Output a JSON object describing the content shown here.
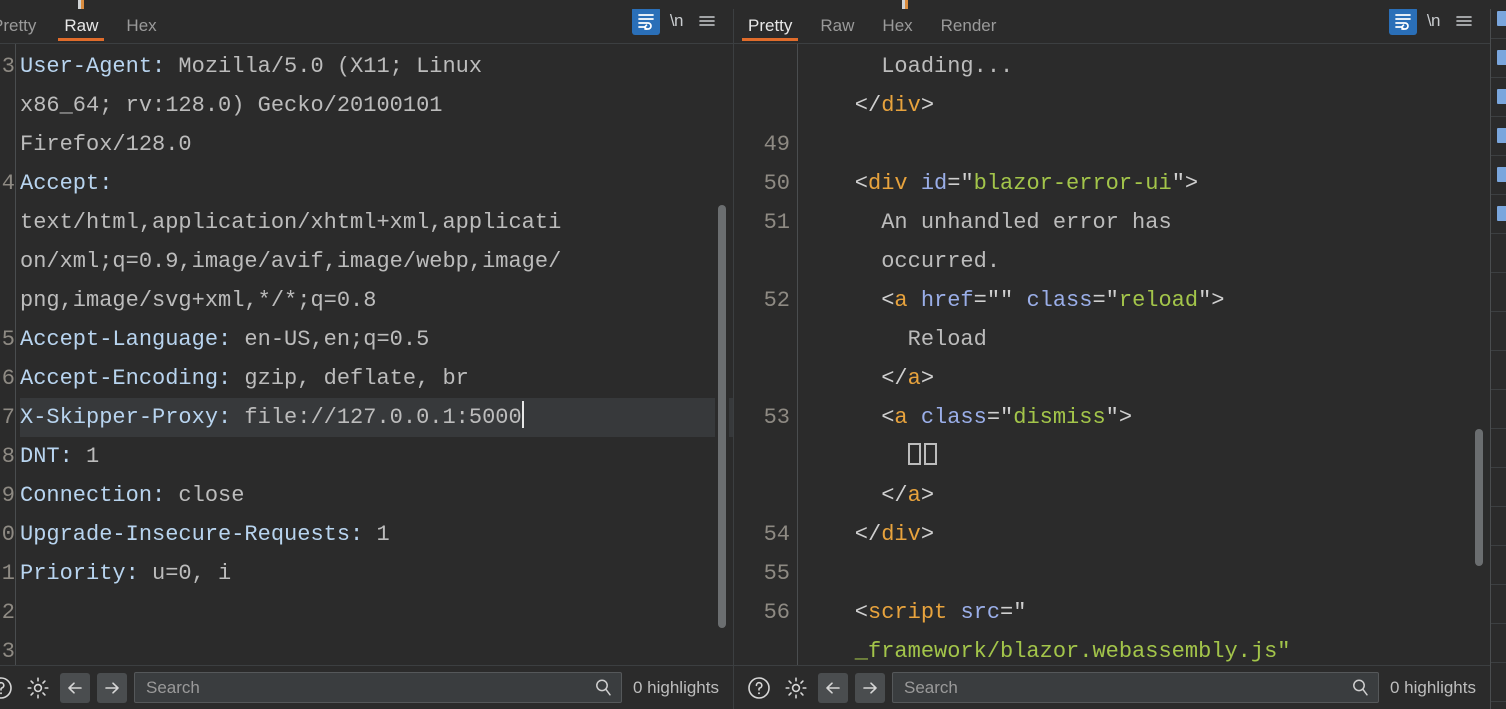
{
  "theme": {
    "background": "#2b2b2b",
    "accent_underline": "#e06c2b",
    "toggle_active": "#2a6fb8",
    "gutter_text": "#8e8a83",
    "tag_color": "#e8a33d",
    "attr_color": "#9aaee8",
    "string_color": "#a3c54a",
    "header_name_color": "#b8d4ef",
    "current_line_bg": "#37393b"
  },
  "request_panel": {
    "name": "request",
    "tabs": [
      {
        "label": "Pretty",
        "active": false,
        "clipped": true
      },
      {
        "label": "Raw",
        "active": true,
        "clipped": false
      },
      {
        "label": "Hex",
        "active": false,
        "clipped": false
      }
    ],
    "actions": {
      "wrap_icon": "word-wrap-icon",
      "wrap_active": true,
      "newline_label": "\\n",
      "menu_icon": "hamburger-menu-icon"
    },
    "line_numbers": [
      "3",
      "",
      "",
      "4",
      "",
      "",
      "",
      "5",
      "6",
      "7",
      "8",
      "9",
      "0",
      "1",
      "2",
      "3"
    ],
    "lines": [
      {
        "number": "3",
        "current": false,
        "tokens": [
          {
            "cls": "t-hdr",
            "text": "User-Agent:"
          },
          {
            "cls": "t-val",
            "text": " Mozilla/5.0 (X11; Linux"
          }
        ]
      },
      {
        "number": "",
        "current": false,
        "tokens": [
          {
            "cls": "t-val",
            "text": "x86_64; rv:128.0) Gecko/20100101"
          }
        ]
      },
      {
        "number": "",
        "current": false,
        "tokens": [
          {
            "cls": "t-val",
            "text": "Firefox/128.0"
          }
        ]
      },
      {
        "number": "4",
        "current": false,
        "tokens": [
          {
            "cls": "t-hdr",
            "text": "Accept:"
          }
        ]
      },
      {
        "number": "",
        "current": false,
        "tokens": [
          {
            "cls": "t-val",
            "text": "text/html,application/xhtml+xml,applicati"
          }
        ]
      },
      {
        "number": "",
        "current": false,
        "tokens": [
          {
            "cls": "t-val",
            "text": "on/xml;q=0.9,image/avif,image/webp,image/"
          }
        ]
      },
      {
        "number": "",
        "current": false,
        "tokens": [
          {
            "cls": "t-val",
            "text": "png,image/svg+xml,*/*;q=0.8"
          }
        ]
      },
      {
        "number": "5",
        "current": false,
        "tokens": [
          {
            "cls": "t-hdr",
            "text": "Accept-Language:"
          },
          {
            "cls": "t-val",
            "text": " en-US,en;q=0.5"
          }
        ]
      },
      {
        "number": "6",
        "current": false,
        "tokens": [
          {
            "cls": "t-hdr",
            "text": "Accept-Encoding:"
          },
          {
            "cls": "t-val",
            "text": " gzip, deflate, br"
          }
        ]
      },
      {
        "number": "7",
        "current": true,
        "caret": true,
        "tokens": [
          {
            "cls": "t-hdr",
            "text": "X-Skipper-Proxy:"
          },
          {
            "cls": "t-val",
            "text": " file://127.0.0.1:5000"
          }
        ]
      },
      {
        "number": "8",
        "current": false,
        "tokens": [
          {
            "cls": "t-hdr",
            "text": "DNT:"
          },
          {
            "cls": "t-val",
            "text": " 1"
          }
        ]
      },
      {
        "number": "9",
        "current": false,
        "tokens": [
          {
            "cls": "t-hdr",
            "text": "Connection:"
          },
          {
            "cls": "t-val",
            "text": " close"
          }
        ]
      },
      {
        "number": "0",
        "current": false,
        "tokens": [
          {
            "cls": "t-hdr",
            "text": "Upgrade-Insecure-Requests:"
          },
          {
            "cls": "t-val",
            "text": " 1"
          }
        ]
      },
      {
        "number": "1",
        "current": false,
        "tokens": [
          {
            "cls": "t-hdr",
            "text": "Priority:"
          },
          {
            "cls": "t-val",
            "text": " u=0, i"
          }
        ]
      },
      {
        "number": "2",
        "current": false,
        "tokens": []
      },
      {
        "number": "3",
        "current": false,
        "tokens": []
      }
    ],
    "scrollbar": {
      "top_pct": 26,
      "height_pct": 68
    },
    "bottom": {
      "help_icon": "help-circle-icon",
      "settings_icon": "gear-icon",
      "prev_icon": "arrow-left-icon",
      "next_icon": "arrow-right-icon",
      "search_placeholder": "Search",
      "search_value": "",
      "search_icon": "magnifier-icon",
      "highlights_label": "0 highlights"
    }
  },
  "response_panel": {
    "name": "response",
    "tabs": [
      {
        "label": "Pretty",
        "active": true,
        "clipped": false
      },
      {
        "label": "Raw",
        "active": false,
        "clipped": false
      },
      {
        "label": "Hex",
        "active": false,
        "clipped": false
      },
      {
        "label": "Render",
        "active": false,
        "clipped": false
      }
    ],
    "actions": {
      "wrap_icon": "word-wrap-icon",
      "wrap_active": true,
      "newline_label": "\\n",
      "menu_icon": "hamburger-menu-icon"
    },
    "lines": [
      {
        "number": "",
        "tokens": [
          {
            "cls": "t-text",
            "text": "      Loading..."
          }
        ]
      },
      {
        "number": "",
        "tokens": [
          {
            "cls": "t-punct",
            "text": "    </"
          },
          {
            "cls": "t-tag",
            "text": "div"
          },
          {
            "cls": "t-punct",
            "text": ">"
          }
        ]
      },
      {
        "number": "49",
        "tokens": []
      },
      {
        "number": "50",
        "tokens": [
          {
            "cls": "t-punct",
            "text": "    <"
          },
          {
            "cls": "t-tag",
            "text": "div"
          },
          {
            "cls": "t-punct",
            "text": " "
          },
          {
            "cls": "t-attr",
            "text": "id"
          },
          {
            "cls": "t-punct",
            "text": "="
          },
          {
            "cls": "t-punct",
            "text": "\""
          },
          {
            "cls": "t-str",
            "text": "blazor-error-ui"
          },
          {
            "cls": "t-punct",
            "text": "\">"
          }
        ]
      },
      {
        "number": "51",
        "tokens": [
          {
            "cls": "t-text",
            "text": "      An unhandled error has"
          }
        ]
      },
      {
        "number": "",
        "tokens": [
          {
            "cls": "t-text",
            "text": "      occurred."
          }
        ]
      },
      {
        "number": "52",
        "tokens": [
          {
            "cls": "t-punct",
            "text": "      <"
          },
          {
            "cls": "t-tag",
            "text": "a"
          },
          {
            "cls": "t-punct",
            "text": " "
          },
          {
            "cls": "t-attr",
            "text": "href"
          },
          {
            "cls": "t-punct",
            "text": "=\"\" "
          },
          {
            "cls": "t-attr",
            "text": "class"
          },
          {
            "cls": "t-punct",
            "text": "=\""
          },
          {
            "cls": "t-str",
            "text": "reload"
          },
          {
            "cls": "t-punct",
            "text": "\">"
          }
        ]
      },
      {
        "number": "",
        "tokens": [
          {
            "cls": "t-text",
            "text": "        Reload"
          }
        ]
      },
      {
        "number": "",
        "tokens": [
          {
            "cls": "t-punct",
            "text": "      </"
          },
          {
            "cls": "t-tag",
            "text": "a"
          },
          {
            "cls": "t-punct",
            "text": ">"
          }
        ]
      },
      {
        "number": "53",
        "tokens": [
          {
            "cls": "t-punct",
            "text": "      <"
          },
          {
            "cls": "t-tag",
            "text": "a"
          },
          {
            "cls": "t-punct",
            "text": " "
          },
          {
            "cls": "t-attr",
            "text": "class"
          },
          {
            "cls": "t-punct",
            "text": "=\""
          },
          {
            "cls": "t-str",
            "text": "dismiss"
          },
          {
            "cls": "t-punct",
            "text": "\">"
          }
        ]
      },
      {
        "number": "",
        "tofu": 2,
        "indent": "        ",
        "tokens": []
      },
      {
        "number": "",
        "tokens": [
          {
            "cls": "t-punct",
            "text": "      </"
          },
          {
            "cls": "t-tag",
            "text": "a"
          },
          {
            "cls": "t-punct",
            "text": ">"
          }
        ]
      },
      {
        "number": "54",
        "tokens": [
          {
            "cls": "t-punct",
            "text": "    </"
          },
          {
            "cls": "t-tag",
            "text": "div"
          },
          {
            "cls": "t-punct",
            "text": ">"
          }
        ]
      },
      {
        "number": "55",
        "tokens": []
      },
      {
        "number": "56",
        "tokens": [
          {
            "cls": "t-punct",
            "text": "    <"
          },
          {
            "cls": "t-tag",
            "text": "script"
          },
          {
            "cls": "t-punct",
            "text": " "
          },
          {
            "cls": "t-attr",
            "text": "src"
          },
          {
            "cls": "t-punct",
            "text": "=\""
          }
        ]
      },
      {
        "number": "",
        "tokens": [
          {
            "cls": "t-str",
            "text": "    _framework/blazor.webassembly.js\""
          }
        ]
      }
    ],
    "scrollbar": {
      "top_pct": 62,
      "height_pct": 22
    },
    "bottom": {
      "help_icon": "help-circle-icon",
      "settings_icon": "gear-icon",
      "prev_icon": "arrow-left-icon",
      "next_icon": "arrow-right-icon",
      "search_placeholder": "Search",
      "search_value": "",
      "search_icon": "magnifier-icon",
      "highlights_label": "0 highlights"
    }
  },
  "edge_panel": {
    "name": "clipped-list-panel",
    "row_count": 18,
    "filled_rows": 6
  }
}
